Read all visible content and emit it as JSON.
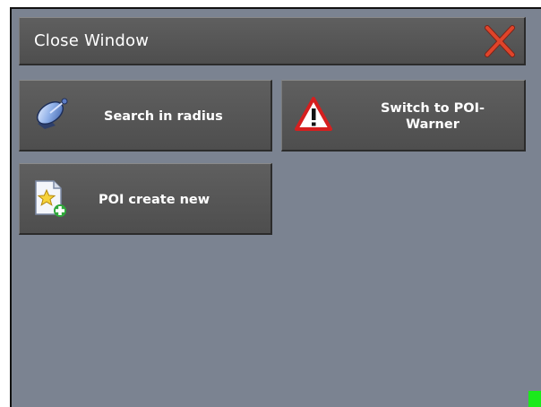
{
  "window": {
    "title": "Close Window",
    "close_icon": "close-x-icon"
  },
  "menu": {
    "items": [
      {
        "label": "Search in radius",
        "icon": "satellite-dish-icon"
      },
      {
        "label": "Switch to POI-Warner",
        "icon": "warning-triangle-icon"
      },
      {
        "label": "POI create new",
        "icon": "new-document-star-icon"
      }
    ]
  },
  "status": {
    "led_color": "#1bea1b"
  },
  "colors": {
    "background": "#7b8391",
    "button": "#575757",
    "close_red": "#e0442a"
  }
}
